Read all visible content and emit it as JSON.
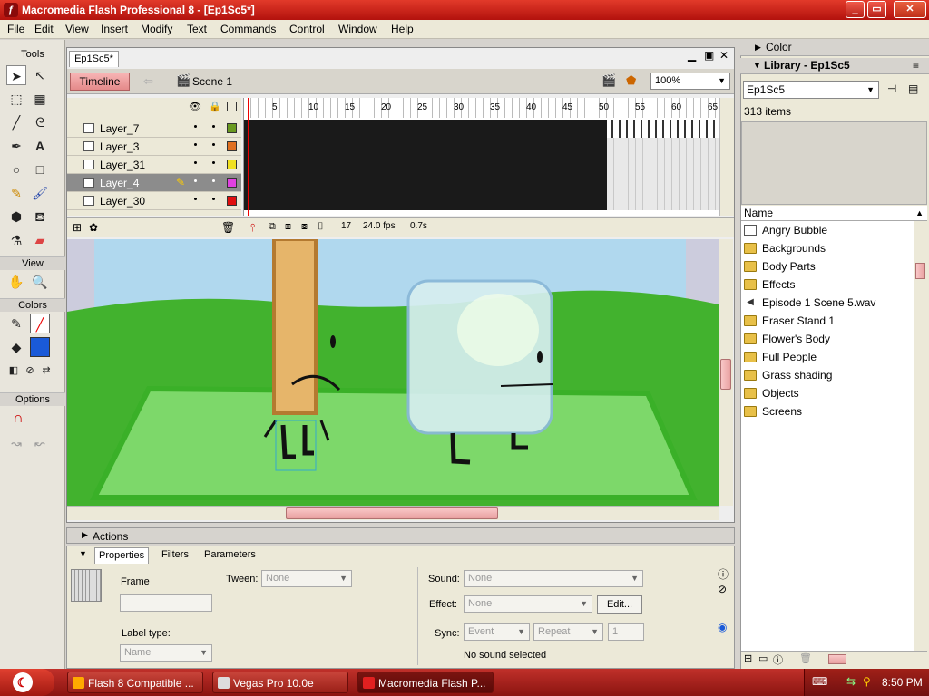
{
  "window": {
    "title": "Macromedia Flash Professional 8 - [Ep1Sc5*]"
  },
  "menu": [
    "File",
    "Edit",
    "View",
    "Insert",
    "Modify",
    "Text",
    "Commands",
    "Control",
    "Window",
    "Help"
  ],
  "tools": {
    "title": "Tools",
    "view": "View",
    "colors": "Colors",
    "options": "Options"
  },
  "document": {
    "tab": "Ep1Sc5*",
    "timeline_button": "Timeline",
    "scene": "Scene 1",
    "zoom": "100%"
  },
  "timeline": {
    "layers": [
      {
        "name": "Layer_7",
        "color": "#6a9a20"
      },
      {
        "name": "Layer_3",
        "color": "#e07020"
      },
      {
        "name": "Layer_31",
        "color": "#f0e020"
      },
      {
        "name": "Layer_4",
        "color": "#e040e0"
      },
      {
        "name": "Layer_30",
        "color": "#e01010"
      }
    ],
    "frame_numbers": [
      "5",
      "10",
      "15",
      "20",
      "25",
      "30",
      "35",
      "40",
      "45",
      "50",
      "55",
      "60",
      "65"
    ],
    "current_frame": "17",
    "fps": "24.0 fps",
    "time": "0.7s"
  },
  "actions": {
    "label": "Actions"
  },
  "properties": {
    "tabs": [
      "Properties",
      "Filters",
      "Parameters"
    ],
    "frame_label": "Frame",
    "label_type": "Label type:",
    "label_type_value": "Name",
    "tween_label": "Tween:",
    "tween_value": "None",
    "sound_label": "Sound:",
    "sound_value": "None",
    "effect_label": "Effect:",
    "effect_value": "None",
    "edit_button": "Edit...",
    "sync_label": "Sync:",
    "sync_value": "Event",
    "repeat_value": "Repeat",
    "repeat_count": "1",
    "no_sound": "No sound selected"
  },
  "color_panel": {
    "title": "Color"
  },
  "library": {
    "title": "Library - Ep1Sc5",
    "selector": "Ep1Sc5",
    "count": "313 items",
    "name_header": "Name",
    "items": [
      {
        "name": "Angry Bubble",
        "icon": "graphic"
      },
      {
        "name": "Backgrounds",
        "icon": "folder"
      },
      {
        "name": "Body Parts",
        "icon": "folder"
      },
      {
        "name": "Effects",
        "icon": "folder"
      },
      {
        "name": "Episode 1 Scene 5.wav",
        "icon": "sound"
      },
      {
        "name": "Eraser Stand 1",
        "icon": "folder"
      },
      {
        "name": "Flower's Body",
        "icon": "folder"
      },
      {
        "name": "Full People",
        "icon": "folder"
      },
      {
        "name": "Grass shading",
        "icon": "folder"
      },
      {
        "name": "Objects",
        "icon": "folder"
      },
      {
        "name": "Screens",
        "icon": "folder"
      }
    ]
  },
  "taskbar": {
    "tasks": [
      "Flash 8 Compatible ...",
      "Vegas Pro 10.0e",
      "Macromedia Flash P..."
    ],
    "clock": "8:50 PM"
  }
}
